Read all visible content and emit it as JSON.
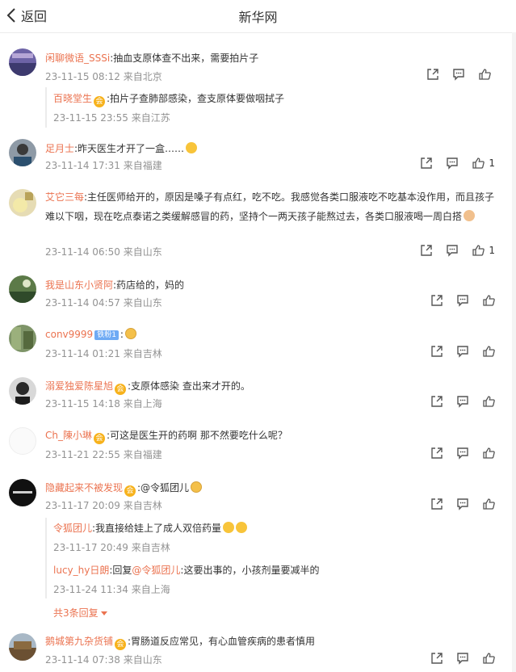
{
  "header": {
    "back_label": "返回",
    "title": "新华网"
  },
  "comments": [
    {
      "user": "闲聊微语_SSSi",
      "text": ":抽血支原体查不出来，需要拍片子",
      "time": "23-11-15 08:12",
      "loc": "来自北京",
      "likes": ""
    },
    {
      "user": "足月士",
      "text": ":昨天医生才开了一盒……",
      "time": "23-11-14 17:31",
      "loc": "来自福建",
      "likes": "1"
    },
    {
      "user": "艾它三每",
      "text": ":主任医师给开的，原因是嗓子有点红，吃不吃。我感觉各类口服液吃不吃基本没作用，而且孩子难以下咽，现在吃点泰诺之类缓解感冒的药，坚持个一两天孩子能熬过去，各类口服液喝一周白搭",
      "time": "23-11-14 06:50",
      "loc": "来自山东",
      "likes": "1"
    },
    {
      "user": "我是山东小贤阿",
      "text": ":药店给的，妈的",
      "time": "23-11-14 04:57",
      "loc": "来自山东",
      "likes": ""
    },
    {
      "user": "conv9999",
      "tag": "铁粉1",
      "text": ":",
      "time": "23-11-14 01:21",
      "loc": "来自吉林",
      "likes": ""
    },
    {
      "user": "溺爱独爱陈星旭",
      "text": ":支原体感染 查出来才开的。",
      "time": "23-11-15 14:18",
      "loc": "来自上海",
      "likes": ""
    },
    {
      "user": "Ch_陳小琳",
      "text": ":可这是医生开的药啊 那不然要吃什么呢？",
      "time": "23-11-21 22:55",
      "loc": "来自福建",
      "likes": ""
    },
    {
      "user": "隐藏起来不被发现",
      "text": ":@令狐团儿",
      "time": "23-11-17 20:09",
      "loc": "来自吉林",
      "likes": ""
    },
    {
      "user": "鹅城第九杂货铺",
      "text": ":胃肠道反应常见，有心血管疾病的患者慎用",
      "time": "23-11-14 07:38",
      "loc": "来自山东",
      "likes": ""
    }
  ],
  "replies": {
    "r1": {
      "user": "百晓堂生",
      "text": ":拍片子查肺部感染，查支原体要做咽拭子",
      "time": "23-11-15 23:55",
      "loc": "来自江苏"
    },
    "r2": {
      "user": "令狐团儿",
      "text": ":我直接给娃上了成人双倍药量",
      "time": "23-11-17 20:49",
      "loc": "来自吉林"
    },
    "r3": {
      "user": "lucy_hy日朗",
      "reply_word": ":回复",
      "mention": "@令狐团儿",
      "text": ":这要出事的，小孩剂量要减半的",
      "time": "23-11-24 11:34",
      "loc": "来自上海"
    },
    "more": "共3条回复"
  },
  "badge_char": "会",
  "colors": {
    "username": "#eb7350",
    "meta": "#939393",
    "text": "#333333"
  },
  "icons": [
    "share-icon",
    "comment-icon",
    "like-icon",
    "back-chevron-icon"
  ]
}
